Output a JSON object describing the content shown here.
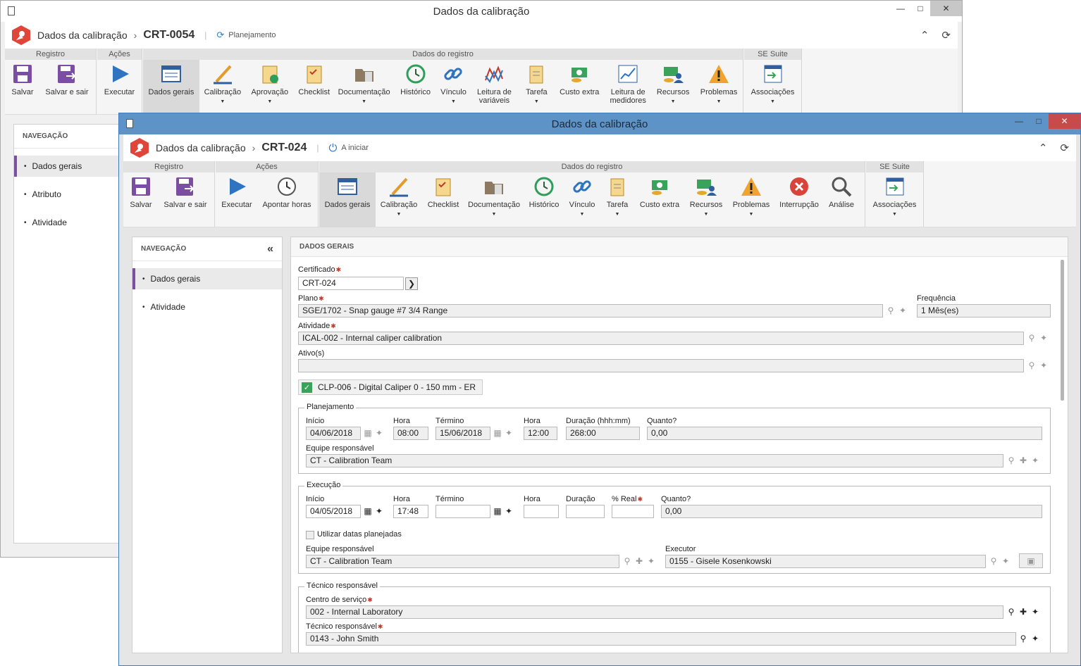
{
  "back_window": {
    "title": "Dados da calibração",
    "header": {
      "title": "Dados da calibração",
      "code": "CRT-0054",
      "status": "Planejamento"
    },
    "ribbon": {
      "groups": [
        {
          "label": "Registro",
          "buttons": [
            "Salvar",
            "Salvar e sair"
          ]
        },
        {
          "label": "Ações",
          "buttons": [
            "Executar"
          ]
        },
        {
          "label": "Dados do registro",
          "buttons": [
            "Dados gerais",
            "Calibração",
            "Aprovação",
            "Checklist",
            "Documentação",
            "Histórico",
            "Vínculo",
            "Leitura de variáveis",
            "Tarefa",
            "Custo extra",
            "Leitura de medidores",
            "Recursos",
            "Problemas"
          ]
        },
        {
          "label": "SE Suite",
          "buttons": [
            "Associações"
          ]
        }
      ]
    },
    "nav": {
      "title": "NAVEGAÇÃO",
      "items": [
        "Dados gerais",
        "Atributo",
        "Atividade"
      ]
    }
  },
  "front_window": {
    "title": "Dados da calibração",
    "header": {
      "title": "Dados da calibração",
      "code": "CRT-024",
      "status": "A iniciar"
    },
    "ribbon": {
      "groups": [
        {
          "label": "Registro",
          "buttons": [
            "Salvar",
            "Salvar e sair"
          ]
        },
        {
          "label": "Ações",
          "buttons": [
            "Executar",
            "Apontar horas"
          ]
        },
        {
          "label": "Dados do registro",
          "buttons": [
            "Dados gerais",
            "Calibração",
            "Checklist",
            "Documentação",
            "Histórico",
            "Vínculo",
            "Tarefa",
            "Custo extra",
            "Recursos",
            "Problemas",
            "Interrupção",
            "Análise"
          ]
        },
        {
          "label": "SE Suite",
          "buttons": [
            "Associações"
          ]
        }
      ]
    },
    "nav": {
      "title": "NAVEGAÇÃO",
      "items": [
        "Dados gerais",
        "Atividade"
      ]
    },
    "form": {
      "section_title": "DADOS GERAIS",
      "certificado": {
        "label": "Certificado",
        "value": "CRT-024"
      },
      "plano": {
        "label": "Plano",
        "value": "SGE/1702 - Snap gauge #7 3/4 Range"
      },
      "frequencia": {
        "label": "Frequência",
        "value": "1 Mês(es)"
      },
      "atividade": {
        "label": "Atividade",
        "value": "ICAL-002 - Internal caliper calibration"
      },
      "ativos": {
        "label": "Ativo(s)",
        "value": ""
      },
      "asset_tag": "CLP-006 - Digital Caliper 0 - 150 mm - ER",
      "planejamento": {
        "title": "Planejamento",
        "inicio_label": "Início",
        "inicio": "04/06/2018",
        "hora_label": "Hora",
        "hora": "08:00",
        "termino_label": "Término",
        "termino": "15/06/2018",
        "hora2_label": "Hora",
        "hora2": "12:00",
        "duracao_label": "Duração (hhh:mm)",
        "duracao": "268:00",
        "quanto_label": "Quanto?",
        "quanto": "0,00",
        "equipe_label": "Equipe responsável",
        "equipe": "CT - Calibration Team"
      },
      "execucao": {
        "title": "Execução",
        "inicio_label": "Início",
        "inicio": "04/05/2018",
        "hora_label": "Hora",
        "hora": "17:48",
        "termino_label": "Término",
        "termino": "",
        "hora2_label": "Hora",
        "hora2": "",
        "duracao_label": "Duração",
        "duracao": "",
        "real_label": "% Real",
        "real": "",
        "quanto_label": "Quanto?",
        "quanto": "0,00",
        "usar_datas": "Utilizar datas planejadas",
        "equipe_label": "Equipe responsável",
        "equipe": "CT - Calibration Team",
        "executor_label": "Executor",
        "executor": "0155 - Gisele Kosenkowski"
      },
      "tecnico": {
        "title": "Técnico responsável",
        "centro_label": "Centro de serviço",
        "centro": "002 - Internal Laboratory",
        "tecnico_label": "Técnico responsável",
        "tecnico": "0143 - John Smith"
      }
    }
  }
}
